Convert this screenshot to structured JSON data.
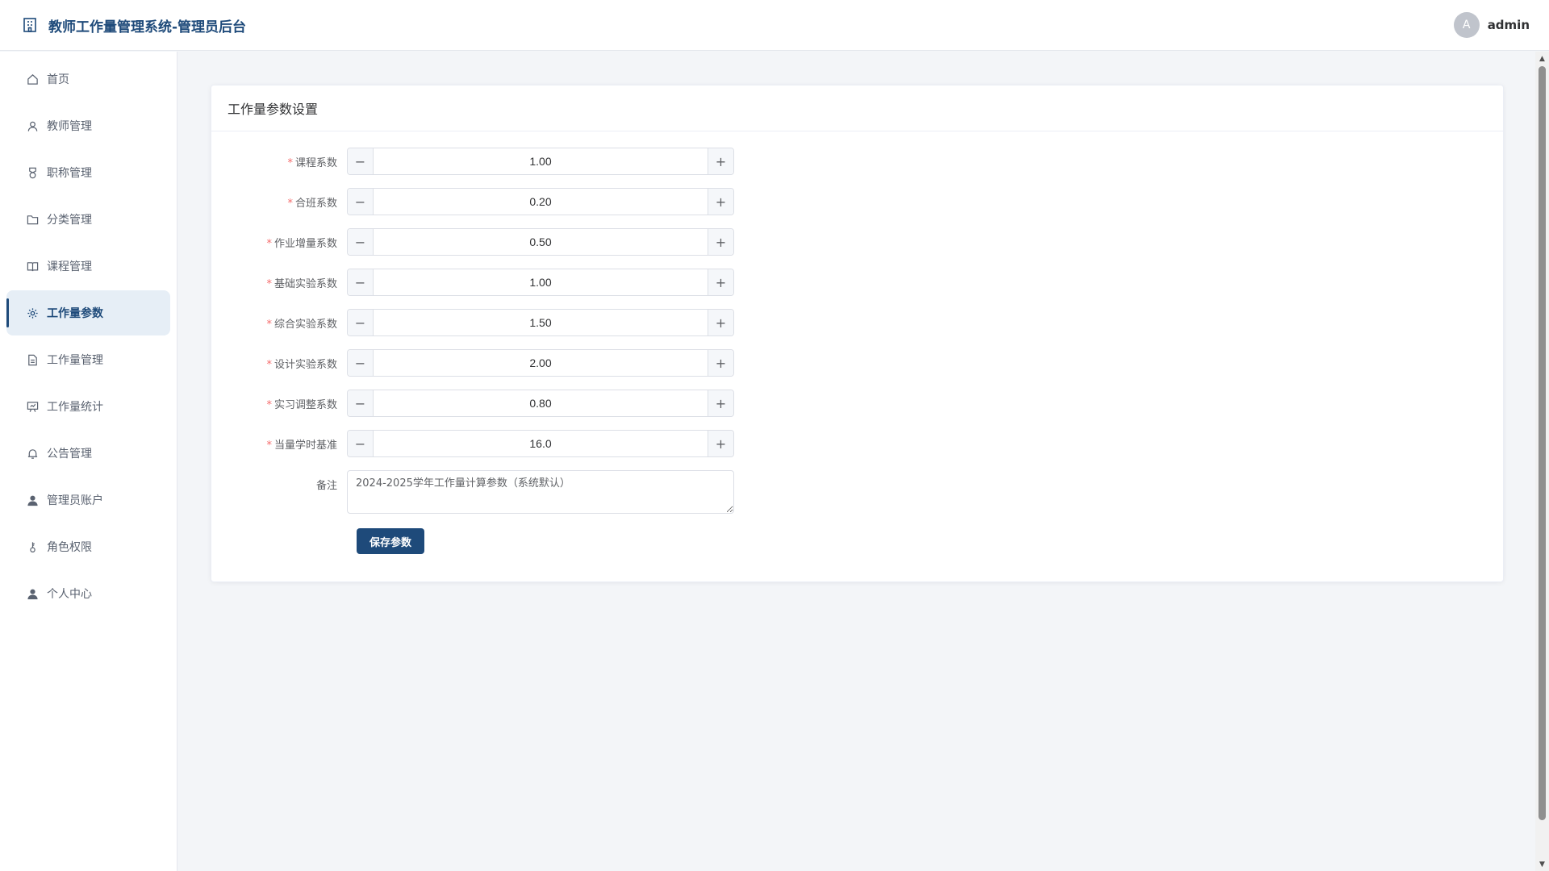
{
  "header": {
    "title": "教师工作量管理系统-管理员后台",
    "avatar_letter": "A",
    "username": "admin"
  },
  "sidebar": {
    "items": [
      {
        "label": "首页",
        "icon": "home-icon"
      },
      {
        "label": "教师管理",
        "icon": "user-icon"
      },
      {
        "label": "职称管理",
        "icon": "medal-icon"
      },
      {
        "label": "分类管理",
        "icon": "folder-icon"
      },
      {
        "label": "课程管理",
        "icon": "book-icon"
      },
      {
        "label": "工作量参数",
        "icon": "gear-icon",
        "active": true
      },
      {
        "label": "工作量管理",
        "icon": "document-icon"
      },
      {
        "label": "工作量统计",
        "icon": "presentation-icon"
      },
      {
        "label": "公告管理",
        "icon": "bell-icon"
      },
      {
        "label": "管理员账户",
        "icon": "user-filled-icon"
      },
      {
        "label": "角色权限",
        "icon": "key-icon"
      },
      {
        "label": "个人中心",
        "icon": "user-filled-icon"
      }
    ]
  },
  "card": {
    "title": "工作量参数设置"
  },
  "form": {
    "fields": [
      {
        "label": "课程系数",
        "value": "1.00",
        "required": true
      },
      {
        "label": "合班系数",
        "value": "0.20",
        "required": true
      },
      {
        "label": "作业增量系数",
        "value": "0.50",
        "required": true
      },
      {
        "label": "基础实验系数",
        "value": "1.00",
        "required": true
      },
      {
        "label": "综合实验系数",
        "value": "1.50",
        "required": true
      },
      {
        "label": "设计实验系数",
        "value": "2.00",
        "required": true
      },
      {
        "label": "实习调整系数",
        "value": "0.80",
        "required": true
      },
      {
        "label": "当量学时基准",
        "value": "16.0",
        "required": true
      }
    ],
    "required_mark": "*",
    "minus_symbol": "−",
    "plus_symbol": "+",
    "remark_label": "备注",
    "remark_value": "2024-2025学年工作量计算参数（系统默认）",
    "save_label": "保存参数"
  },
  "colors": {
    "primary": "#1e4a7a",
    "active_bg": "#e6eef6",
    "required": "#f56c6c"
  }
}
